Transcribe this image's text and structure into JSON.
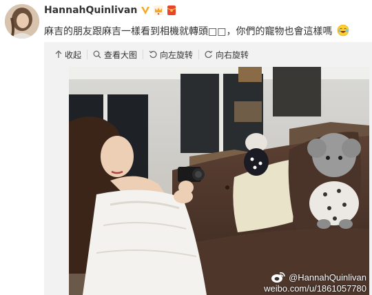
{
  "post": {
    "username": "HannahQuinlivan",
    "text": "麻吉的朋友跟麻吉一樣看到相機就轉頭□□，你們的寵物也會這樣嗎",
    "badges": [
      "verified-badge",
      "crown-badge",
      "hongbao-badge"
    ]
  },
  "media_toolbar": {
    "collapse": "收起",
    "view_large": "查看大图",
    "rotate_left": "向左旋转",
    "rotate_right": "向右旋转"
  },
  "watermark": {
    "handle": "@HannahQuinlivan",
    "url": "weibo.com/u/1861057780"
  },
  "colors": {
    "badge_gold": "#f5a623",
    "toolbar_bg": "#f2f2f2",
    "text": "#333333"
  }
}
